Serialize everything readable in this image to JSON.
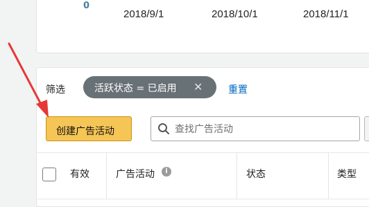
{
  "chart": {
    "y_tick": "0",
    "x_ticks": [
      "2018/9/1",
      "2018/10/1",
      "2018/11/1"
    ]
  },
  "filter": {
    "label": "筛选",
    "chip_text": "活跃状态 = 已启用",
    "chip_close": "✕",
    "reset": "重置"
  },
  "toolbar": {
    "create_label": "创建广告活动",
    "search_placeholder": "查找广告活动"
  },
  "table": {
    "columns": [
      "有效",
      "广告活动",
      "状态",
      "类型"
    ]
  },
  "annotation": {
    "arrow_color": "#e53935"
  }
}
